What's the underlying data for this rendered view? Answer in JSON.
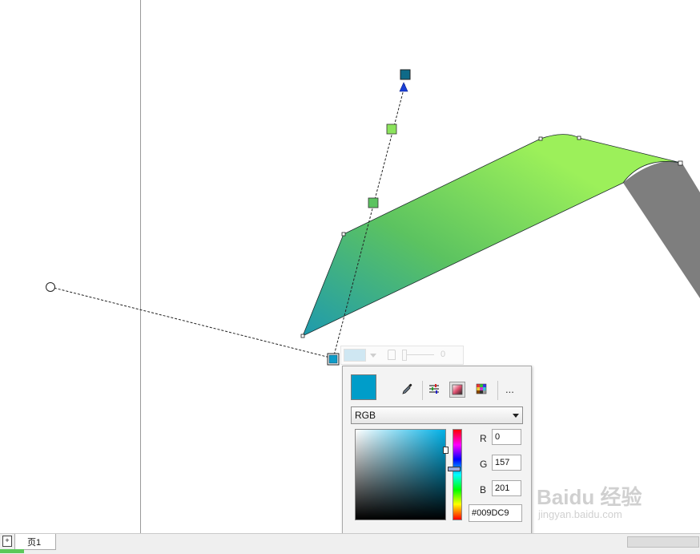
{
  "colors": {
    "current_fill": "#009DC9",
    "ribbon_light": "#9CF05A",
    "ribbon_dark": "#1E9AAE",
    "shadow": "#7E7E7E",
    "handle_start": "#0E9CC8",
    "handle_end": "#0F6A88"
  },
  "picker": {
    "color_model": "RGB",
    "channels": [
      {
        "label": "R",
        "value": "0"
      },
      {
        "label": "G",
        "value": "157"
      },
      {
        "label": "B",
        "value": "201"
      }
    ],
    "hex": "#009DC9",
    "more_label": "...",
    "tools": [
      "eyedropper-icon",
      "sliders-icon",
      "color-viewer-icon",
      "palette-icon"
    ]
  },
  "ghost_toolbar": {
    "value": "0"
  },
  "status": {
    "page_tab": "页1"
  },
  "watermark": {
    "line1": "Baidu 经验",
    "line2": "jingyan.baidu.com"
  }
}
